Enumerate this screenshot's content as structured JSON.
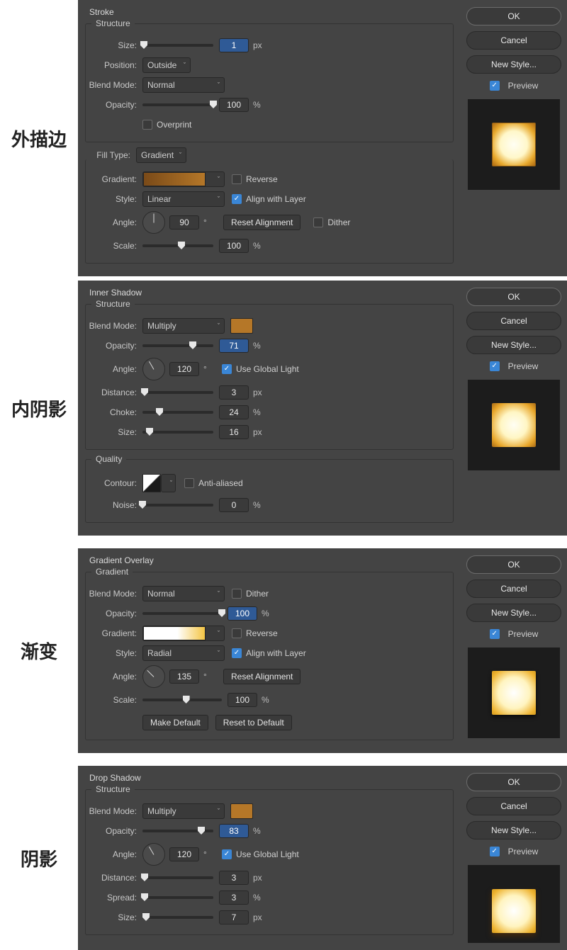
{
  "common": {
    "ok": "OK",
    "cancel": "Cancel",
    "newstyle": "New Style...",
    "preview": "Preview",
    "px": "px",
    "pct": "%",
    "deg": "°"
  },
  "cn": {
    "stroke": "外描边",
    "inner": "内阴影",
    "grad": "渐变",
    "drop": "阴影"
  },
  "stroke": {
    "title": "Stroke",
    "structure": "Structure",
    "size_l": "Size:",
    "size_v": "1",
    "position_l": "Position:",
    "position_v": "Outside",
    "blend_l": "Blend Mode:",
    "blend_v": "Normal",
    "opacity_l": "Opacity:",
    "opacity_v": "100",
    "overprint": "Overprint",
    "filltype_l": "Fill Type:",
    "filltype_v": "Gradient",
    "gradient_l": "Gradient:",
    "reverse": "Reverse",
    "style_l": "Style:",
    "style_v": "Linear",
    "align": "Align with Layer",
    "angle_l": "Angle:",
    "angle_v": "90",
    "resetalign": "Reset Alignment",
    "dither": "Dither",
    "scale_l": "Scale:",
    "scale_v": "100"
  },
  "inner": {
    "title": "Inner Shadow",
    "structure": "Structure",
    "blend_l": "Blend Mode:",
    "blend_v": "Multiply",
    "color": "#b57728",
    "opacity_l": "Opacity:",
    "opacity_v": "71",
    "angle_l": "Angle:",
    "angle_v": "120",
    "usegl": "Use Global Light",
    "distance_l": "Distance:",
    "distance_v": "3",
    "choke_l": "Choke:",
    "choke_v": "24",
    "size_l": "Size:",
    "size_v": "16",
    "quality": "Quality",
    "contour_l": "Contour:",
    "aa": "Anti-aliased",
    "noise_l": "Noise:",
    "noise_v": "0"
  },
  "grad": {
    "title": "Gradient Overlay",
    "gradient_legend": "Gradient",
    "blend_l": "Blend Mode:",
    "blend_v": "Normal",
    "dither": "Dither",
    "opacity_l": "Opacity:",
    "opacity_v": "100",
    "gradient_l": "Gradient:",
    "reverse": "Reverse",
    "style_l": "Style:",
    "style_v": "Radial",
    "align": "Align with Layer",
    "angle_l": "Angle:",
    "angle_v": "135",
    "resetalign": "Reset Alignment",
    "scale_l": "Scale:",
    "scale_v": "100",
    "makedefault": "Make Default",
    "resetdefault": "Reset to Default"
  },
  "drop": {
    "title": "Drop Shadow",
    "structure": "Structure",
    "blend_l": "Blend Mode:",
    "blend_v": "Multiply",
    "color": "#b57728",
    "opacity_l": "Opacity:",
    "opacity_v": "83",
    "angle_l": "Angle:",
    "angle_v": "120",
    "usegl": "Use Global Light",
    "distance_l": "Distance:",
    "distance_v": "3",
    "spread_l": "Spread:",
    "spread_v": "3",
    "size_l": "Size:",
    "size_v": "7"
  }
}
